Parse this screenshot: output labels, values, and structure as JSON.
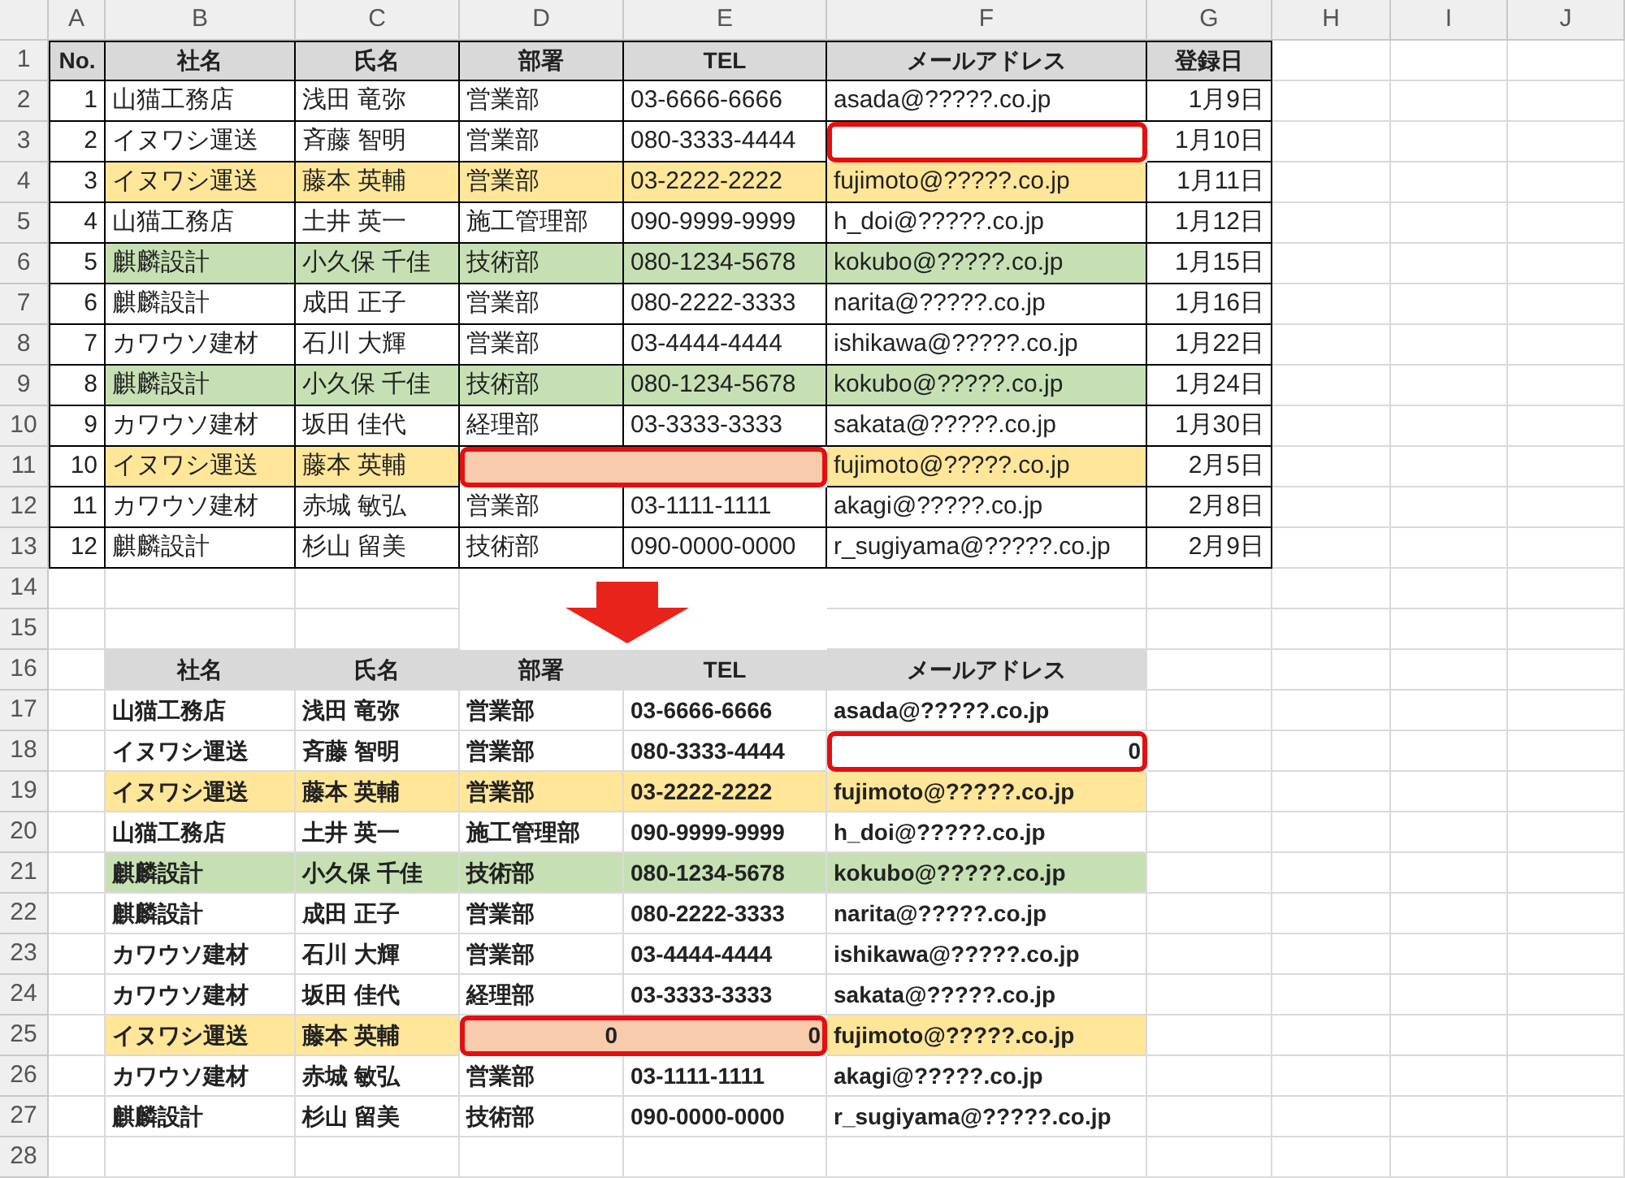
{
  "sheet": {
    "column_letters": [
      "A",
      "B",
      "C",
      "D",
      "E",
      "F",
      "G",
      "H",
      "I",
      "J"
    ],
    "row_numbers": [
      "1",
      "2",
      "3",
      "4",
      "5",
      "6",
      "7",
      "8",
      "9",
      "10",
      "11",
      "12",
      "13",
      "14",
      "15",
      "16",
      "17",
      "18",
      "19",
      "20",
      "21",
      "22",
      "23",
      "24",
      "25",
      "26",
      "27",
      "28"
    ]
  },
  "table_1": {
    "columns": [
      {
        "label": "No.",
        "kind": "number"
      },
      {
        "label": "社名",
        "kind": "text"
      },
      {
        "label": "氏名",
        "kind": "text"
      },
      {
        "label": "部署",
        "kind": "text"
      },
      {
        "label": "TEL",
        "kind": "text"
      },
      {
        "label": "メールアドレス",
        "kind": "text"
      },
      {
        "label": "登録日",
        "kind": "date"
      }
    ],
    "rows": [
      {
        "color": "#ffffff",
        "cells": [
          "1",
          "山猫工務店",
          "浅田 竜弥",
          "営業部",
          "03-6666-6666",
          "asada@?????.co.jp",
          "1月9日"
        ]
      },
      {
        "color": "#ffffff",
        "cells": [
          "2",
          "イヌワシ運送",
          "斉藤 智明",
          "営業部",
          "080-3333-4444",
          {
            "flagged": true
          },
          "1月10日"
        ]
      },
      {
        "color": "#ffe699",
        "cells": [
          "3",
          "イヌワシ運送",
          "藤本 英輔",
          "営業部",
          "03-2222-2222",
          "fujimoto@?????.co.jp",
          "1月11日"
        ]
      },
      {
        "color": "#ffffff",
        "cells": [
          "4",
          "山猫工務店",
          "土井 英一",
          "施工管理部",
          "090-9999-9999",
          "h_doi@?????.co.jp",
          "1月12日"
        ]
      },
      {
        "color": "#c6e0b4",
        "cells": [
          "5",
          "麒麟設計",
          "小久保 千佳",
          "技術部",
          "080-1234-5678",
          "kokubo@?????.co.jp",
          "1月15日"
        ]
      },
      {
        "color": "#ffffff",
        "cells": [
          "6",
          "麒麟設計",
          "成田 正子",
          "営業部",
          "080-2222-3333",
          "narita@?????.co.jp",
          "1月16日"
        ]
      },
      {
        "color": "#ffffff",
        "cells": [
          "7",
          "カワウソ建材",
          "石川 大輝",
          "営業部",
          "03-4444-4444",
          "ishikawa@?????.co.jp",
          "1月22日"
        ]
      },
      {
        "color": "#c6e0b4",
        "cells": [
          "8",
          "麒麟設計",
          "小久保 千佳",
          "技術部",
          "080-1234-5678",
          "kokubo@?????.co.jp",
          "1月24日"
        ]
      },
      {
        "color": "#ffffff",
        "cells": [
          "9",
          "カワウソ建材",
          "坂田 佳代",
          "経理部",
          "03-3333-3333",
          "sakata@?????.co.jp",
          "1月30日"
        ]
      },
      {
        "color": "#ffe699",
        "cells": [
          "10",
          "イヌワシ運送",
          "藤本 英輔",
          {
            "flagged": true,
            "color": "#f8cbad"
          },
          {
            "flagged": true,
            "color": "#f8cbad"
          },
          "fujimoto@?????.co.jp",
          "2月5日"
        ]
      },
      {
        "color": "#ffffff",
        "cells": [
          "11",
          "カワウソ建材",
          "赤城 敏弘",
          "営業部",
          "03-1111-1111",
          "akagi@?????.co.jp",
          "2月8日"
        ]
      },
      {
        "color": "#ffffff",
        "cells": [
          "12",
          "麒麟設計",
          "杉山 留美",
          "技術部",
          "090-0000-0000",
          "r_sugiyama@?????.co.jp",
          "2月9日"
        ]
      }
    ]
  },
  "table_2": {
    "columns": [
      {
        "label": "社名",
        "kind": "text"
      },
      {
        "label": "氏名",
        "kind": "text"
      },
      {
        "label": "部署",
        "kind": "text"
      },
      {
        "label": "TEL",
        "kind": "text"
      },
      {
        "label": "メールアドレス",
        "kind": "text"
      }
    ],
    "rows": [
      {
        "color": "#ffffff",
        "cells": [
          "山猫工務店",
          "浅田 竜弥",
          "営業部",
          "03-6666-6666",
          "asada@?????.co.jp"
        ]
      },
      {
        "color": "#ffffff",
        "cells": [
          "イヌワシ運送",
          "斉藤 智明",
          "営業部",
          "080-3333-4444",
          {
            "text": "0",
            "kind": "number",
            "flagged": true
          }
        ]
      },
      {
        "color": "#ffe699",
        "cells": [
          "イヌワシ運送",
          "藤本 英輔",
          "営業部",
          "03-2222-2222",
          "fujimoto@?????.co.jp"
        ]
      },
      {
        "color": "#ffffff",
        "cells": [
          "山猫工務店",
          "土井 英一",
          "施工管理部",
          "090-9999-9999",
          "h_doi@?????.co.jp"
        ]
      },
      {
        "color": "#c6e0b4",
        "cells": [
          "麒麟設計",
          "小久保 千佳",
          "技術部",
          "080-1234-5678",
          "kokubo@?????.co.jp"
        ]
      },
      {
        "color": "#ffffff",
        "cells": [
          "麒麟設計",
          "成田 正子",
          "営業部",
          "080-2222-3333",
          "narita@?????.co.jp"
        ]
      },
      {
        "color": "#ffffff",
        "cells": [
          "カワウソ建材",
          "石川 大輝",
          "営業部",
          "03-4444-4444",
          "ishikawa@?????.co.jp"
        ]
      },
      {
        "color": "#ffffff",
        "cells": [
          "カワウソ建材",
          "坂田 佳代",
          "経理部",
          "03-3333-3333",
          "sakata@?????.co.jp"
        ]
      },
      {
        "color": "#ffe699",
        "cells": [
          "イヌワシ運送",
          "藤本 英輔",
          {
            "text": "0",
            "kind": "number",
            "flagged": true,
            "color": "#f8cbad"
          },
          {
            "text": "0",
            "kind": "number",
            "flagged": true,
            "color": "#f8cbad"
          },
          "fujimoto@?????.co.jp"
        ]
      },
      {
        "color": "#ffffff",
        "cells": [
          "カワウソ建材",
          "赤城 敏弘",
          "営業部",
          "03-1111-1111",
          "akagi@?????.co.jp"
        ]
      },
      {
        "color": "#ffffff",
        "cells": [
          "麒麟設計",
          "杉山 留美",
          "技術部",
          "090-0000-0000",
          "r_sugiyama@?????.co.jp"
        ]
      }
    ]
  }
}
